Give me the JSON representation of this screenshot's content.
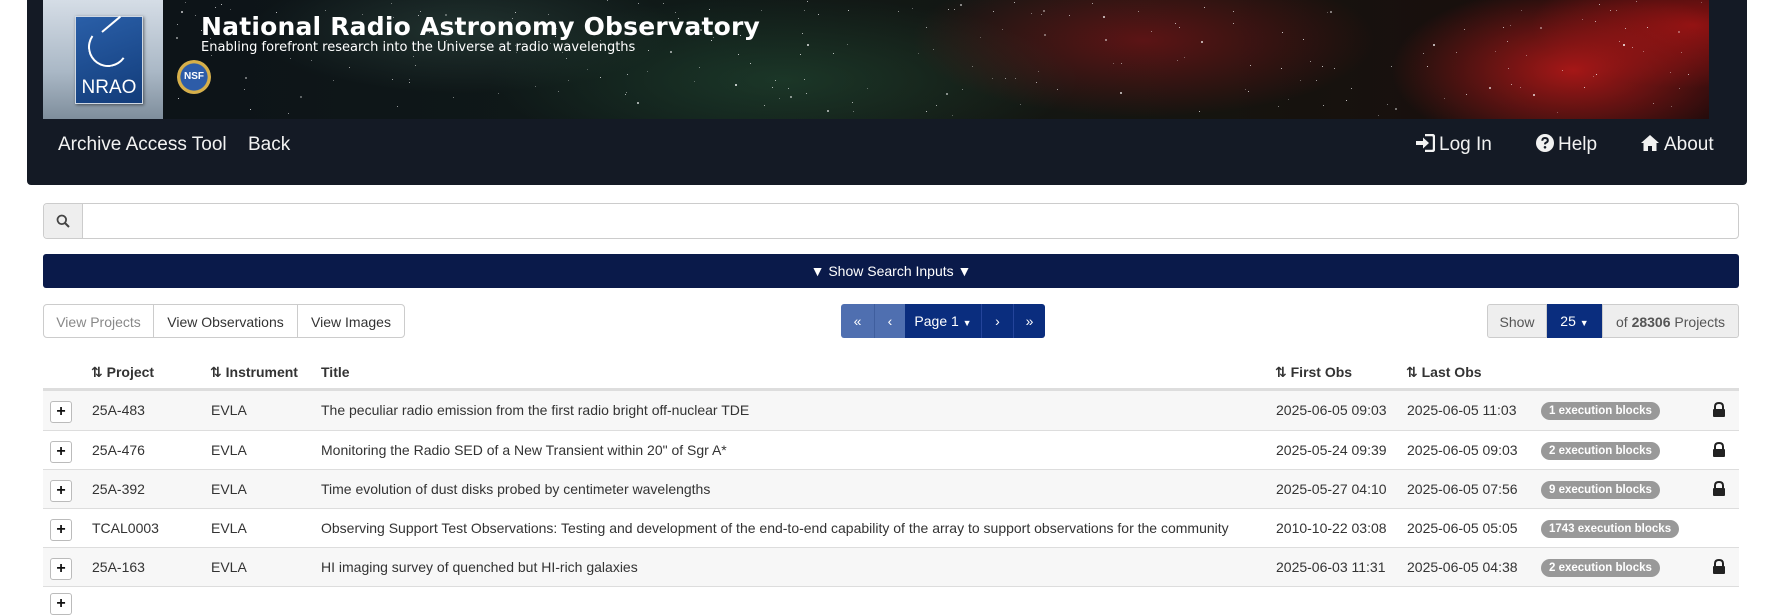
{
  "header": {
    "title": "National Radio Astronomy Observatory",
    "subtitle": "Enabling forefront research into the Universe at radio wavelengths",
    "logo_text": "NRAO",
    "nsf_text": "NSF"
  },
  "nav": {
    "left": [
      {
        "label": "Archive Access Tool"
      },
      {
        "label": "Back"
      }
    ],
    "right": [
      {
        "label": "Log In",
        "icon": "login-icon"
      },
      {
        "label": "Help",
        "icon": "help-icon"
      },
      {
        "label": "About",
        "icon": "home-icon"
      }
    ]
  },
  "search": {
    "value": "",
    "placeholder": ""
  },
  "toggle_label": "▼ Show Search Inputs ▼",
  "views": [
    {
      "label": "View Projects",
      "active": true
    },
    {
      "label": "View Observations",
      "active": false
    },
    {
      "label": "View Images",
      "active": false
    }
  ],
  "pager": {
    "first": "«",
    "prev": "‹",
    "page_label": "Page 1",
    "next": "›",
    "last": "»"
  },
  "show": {
    "label": "Show",
    "count": "25",
    "of_text": "of",
    "total": "28306",
    "unit": "Projects"
  },
  "table": {
    "columns": [
      "Project",
      "Instrument",
      "Title",
      "First Obs",
      "Last Obs"
    ],
    "rows": [
      {
        "project": "25A-483",
        "instrument": "EVLA",
        "title": "The peculiar radio emission from the first radio bright off-nuclear TDE",
        "first_obs": "2025-06-05 09:03",
        "last_obs": "2025-06-05 11:03",
        "badge": "1 execution blocks",
        "locked": true
      },
      {
        "project": "25A-476",
        "instrument": "EVLA",
        "title": "Monitoring the Radio SED of a New Transient within 20\" of Sgr A*",
        "first_obs": "2025-05-24 09:39",
        "last_obs": "2025-06-05 09:03",
        "badge": "2 execution blocks",
        "locked": true
      },
      {
        "project": "25A-392",
        "instrument": "EVLA",
        "title": "Time evolution of dust disks probed by centimeter wavelengths",
        "first_obs": "2025-05-27 04:10",
        "last_obs": "2025-06-05 07:56",
        "badge": "9 execution blocks",
        "locked": true
      },
      {
        "project": "TCAL0003",
        "instrument": "EVLA",
        "title": "Observing Support Test Observations: Testing and development of the end-to-end capability of the array to support observations for the community",
        "first_obs": "2010-10-22 03:08",
        "last_obs": "2025-06-05 05:05",
        "badge": "1743 execution blocks",
        "locked": false
      },
      {
        "project": "25A-163",
        "instrument": "EVLA",
        "title": "HI imaging survey of quenched but HI-rich galaxies",
        "first_obs": "2025-06-03 11:31",
        "last_obs": "2025-06-05 04:38",
        "badge": "2 execution blocks",
        "locked": true
      }
    ]
  },
  "colors": {
    "nav_bg": "#141a25",
    "toggle_bg": "#0a1a4a",
    "pager_dark": "#0a2d7e",
    "pager_light": "#4f6fb0",
    "badge_bg": "#999999"
  }
}
